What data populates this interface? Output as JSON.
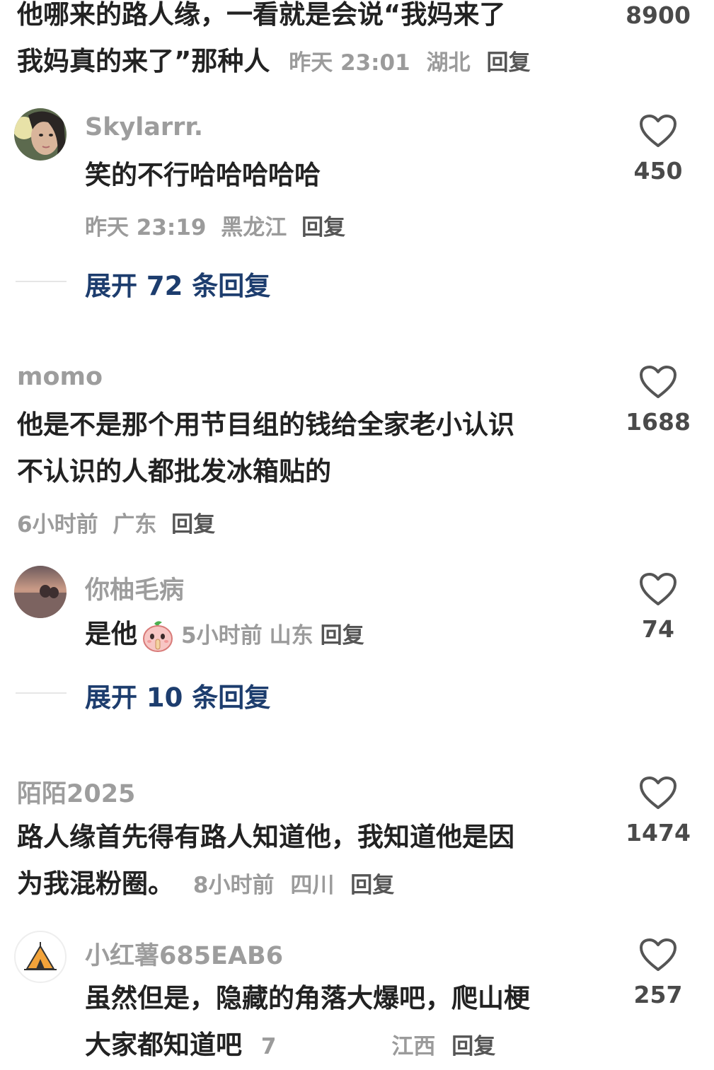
{
  "comments": [
    {
      "lines": [
        "他哪来的路人缘，一看就是会说“我妈来了",
        "我妈真的来了”那种人"
      ],
      "meta": {
        "time": "昨天 23:01",
        "location": "湖北",
        "reply": "回复"
      },
      "likes": "8900"
    },
    {
      "username": "Skylarrr.",
      "text": "笑的不行哈哈哈哈哈",
      "meta": {
        "time": "昨天 23:19",
        "location": "黑龙江",
        "reply": "回复"
      },
      "likes": "450",
      "expand": "展开 72 条回复"
    },
    {
      "username": "momo",
      "lines": [
        "他是不是那个用节目组的钱给全家老小认识",
        "不认识的人都批发冰箱贴的"
      ],
      "meta": {
        "time": "6小时前",
        "location": "广东",
        "reply": "回复"
      },
      "likes": "1688"
    },
    {
      "username": "你柚毛病",
      "text": "是他",
      "meta": {
        "time": "5小时前",
        "location": "山东",
        "reply": "回复"
      },
      "likes": "74",
      "expand": "展开 10 条回复"
    },
    {
      "username": "陌陌2025",
      "lines": [
        "路人缘首先得有路人知道他，我知道他是因",
        "为我混粉圈。"
      ],
      "meta": {
        "time": "8小时前",
        "location": "四川",
        "reply": "回复"
      },
      "likes": "1474"
    },
    {
      "username": "小红薯685EAB6",
      "lines": [
        "虽然但是，隐藏的角落大爆吧，爬山梗",
        "大家都知道吧"
      ],
      "meta": {
        "time": "7",
        "location": "江西",
        "reply": "回复"
      },
      "likes": "257"
    }
  ],
  "icons": {
    "like": "heart-outline-icon",
    "emoji": "peach-shush-emoji"
  },
  "colors": {
    "expand_link": "#1d3d6e",
    "meta_gray": "#9b9b9b",
    "text": "#222222"
  }
}
